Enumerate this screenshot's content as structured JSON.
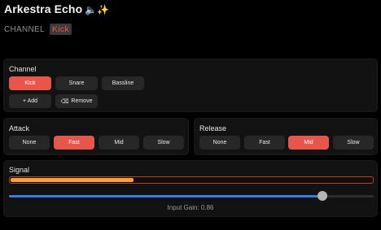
{
  "app": {
    "title": "Arkestra Echo",
    "title_emoji": "🔈✨"
  },
  "channel_line": {
    "label": "CHANNEL",
    "value": "Kick"
  },
  "channel_panel": {
    "title": "Channel",
    "options": [
      "Kick",
      "Snare",
      "Bassline"
    ],
    "selected": "Kick",
    "add_label": "+ Add",
    "remove_label": "Remove",
    "remove_icon": "backspace-icon"
  },
  "attack_panel": {
    "title": "Attack",
    "options": [
      "None",
      "Fast",
      "Mid",
      "Slow"
    ],
    "selected": "Fast"
  },
  "release_panel": {
    "title": "Release",
    "options": [
      "None",
      "Fast",
      "Mid",
      "Slow"
    ],
    "selected": "Mid"
  },
  "signal_panel": {
    "title": "Signal",
    "level": 0.34,
    "input_gain": 0.86,
    "input_gain_label": "Input Gain: 0.86"
  },
  "colors": {
    "accent": "#e8564b",
    "progress": "#f2a33c",
    "slider": "#3b7ddd"
  }
}
